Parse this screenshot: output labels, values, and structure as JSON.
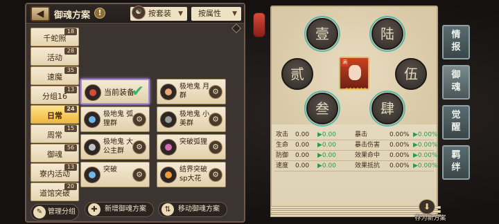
{
  "header": {
    "title": "御魂方案",
    "info_icon": "!",
    "sort_by_suit": "按套装",
    "sort_by_attr": "按属性"
  },
  "categories": [
    {
      "label": "千蛇照",
      "count": "18"
    },
    {
      "label": "活动",
      "count": "28"
    },
    {
      "label": "速魔",
      "count": "35"
    },
    {
      "label": "分组16",
      "count": "13"
    },
    {
      "label": "日常",
      "count": "24"
    },
    {
      "label": "周常",
      "count": "15"
    },
    {
      "label": "御魂",
      "count": "56"
    },
    {
      "label": "寮内活动",
      "count": "13"
    },
    {
      "label": "道馆突破",
      "count": "20"
    }
  ],
  "manage_group": "管理分组",
  "cards": [
    {
      "label": "当前装备",
      "icon": "mitama-icon",
      "color": "#d84a3a",
      "current": true
    },
    {
      "label": "极地鬼 月群",
      "icon": "mitama-icon",
      "color": "#e9a47a"
    },
    {
      "label": "极地鬼 弧狸群",
      "icon": "mitama-icon",
      "color": "#6fb5e8"
    },
    {
      "label": "极地鬼 小美群",
      "icon": "mitama-icon",
      "color": "#9a9a9a"
    },
    {
      "label": "极地鬼 大公主群",
      "icon": "mitama-icon",
      "color": "#c0c0c0"
    },
    {
      "label": "突破弧狸",
      "icon": "mitama-icon",
      "color": "#d46ab0"
    },
    {
      "label": "突破",
      "icon": "mitama-icon",
      "color": "#6fb5e8"
    },
    {
      "label": "结界突破 sp大花",
      "icon": "mitama-icon",
      "color": "#f09a3a"
    }
  ],
  "bottom_buttons": {
    "add": "新增御魂方案",
    "move": "移动御魂方案"
  },
  "slots": [
    "壹",
    "陆",
    "贰",
    "伍",
    "叁",
    "肆"
  ],
  "portrait": {
    "badge": "满",
    "stars": "★★★★★★"
  },
  "stats": [
    {
      "name": "攻击",
      "val": "0.00",
      "delta": "▶0.00",
      "name2": "暴击",
      "val2": "0.00%",
      "delta2": "▶0.00%"
    },
    {
      "name": "生命",
      "val": "0.00",
      "delta": "▶0.00",
      "name2": "暴击伤害",
      "val2": "0.00%",
      "delta2": "▶0.00%"
    },
    {
      "name": "防御",
      "val": "0.00",
      "delta": "▶0.00",
      "name2": "效果命中",
      "val2": "0.00%",
      "delta2": "▶0.00%"
    },
    {
      "name": "速度",
      "val": "0.00",
      "delta": "▶0.00",
      "name2": "效果抵抗",
      "val2": "0.00%",
      "delta2": "▶0.00%"
    }
  ],
  "save_label": "存为新方案",
  "side_tabs": [
    "情报",
    "御魂",
    "觉醒",
    "羁绊"
  ]
}
